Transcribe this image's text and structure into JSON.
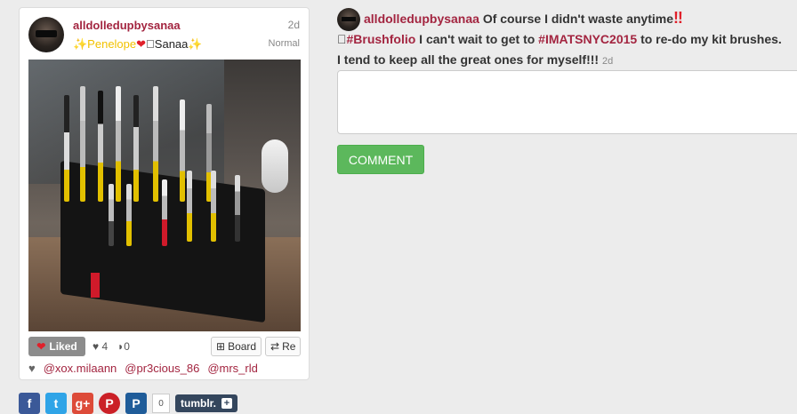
{
  "post": {
    "username": "alldolledupbysanaa",
    "fullname_pre": "✨Penelope",
    "fullname_heart": "❤",
    "fullname_mid": "\u0000Sanaa",
    "fullname_post": "✨",
    "age": "2d",
    "filter": "Normal",
    "likes_button": "Liked",
    "likes_count": "4",
    "comments_count": "0",
    "board_label": "Board",
    "repost_label": "Re",
    "liked_by": [
      "@xox.milaann",
      "@pr3cious_86",
      "@mrs_rld"
    ]
  },
  "share": {
    "count": "0",
    "tumblr_label": "tumblr.",
    "tumblr_plus": "+"
  },
  "caption": {
    "username": "alldolledupbysanaa",
    "text_1": "Of course I didn't waste anytime",
    "bangs": "‼",
    "hashtag_prefix": "\u0000",
    "hashtag_1": "#Brushfolio",
    "text_2": "I can't wait to get to",
    "hashtag_2": "#IMATSNYC2015",
    "text_3": "to re-do my kit brushes. I tend to keep all the great ones for myself!!!",
    "age": "2d"
  },
  "comment_box": {
    "placeholder": "",
    "button_label": "COMMENT"
  },
  "colors": {
    "accent": "#a32540",
    "comment_button": "#5cb85c",
    "liked_bg": "#8c8c8c",
    "tumblr": "#34465d"
  }
}
